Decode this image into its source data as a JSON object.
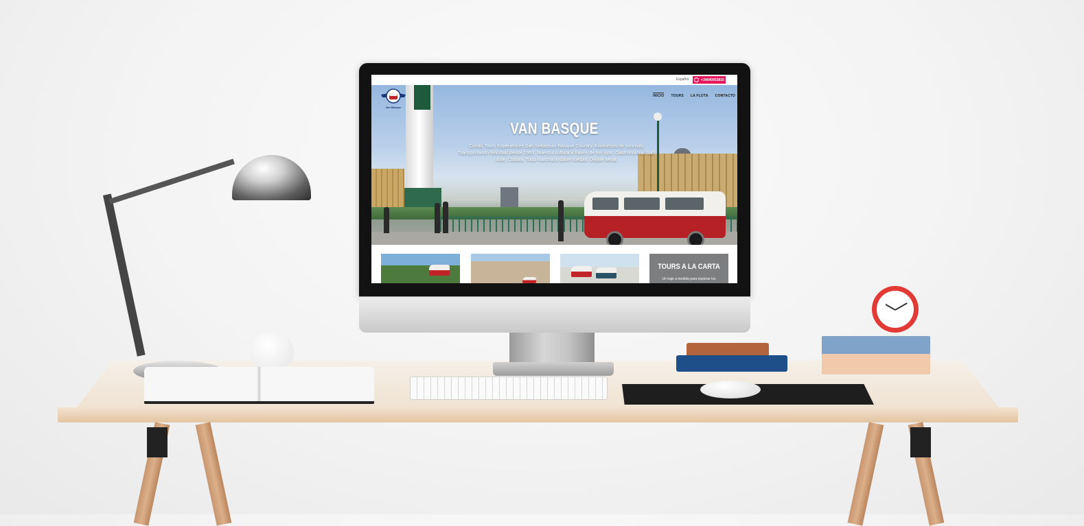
{
  "website": {
    "topbar": {
      "language": "Español",
      "phone": "+34640953816"
    },
    "logo": {
      "label": "Van Basque"
    },
    "nav": [
      "INICIO",
      "TOURS",
      "LA FLOTA",
      "CONTACTO"
    ],
    "hero": {
      "title": "VAN BASQUE",
      "description": "Combi Tours Experiences San Sebastián-Basque Country. Kilómetros de sonrisas. Transportando felicidad desde 1963. Nuestra cultura a través de tus ojos. Gastronomía, Surf, Arte, Cultura. Todo marchará sobre ruedas. Déjate llevar."
    },
    "cards": {
      "tours_a_la_carta": {
        "title": "TOURS A LA CARTA",
        "subtitle": "Un traje a medida para explorar los"
      }
    }
  },
  "colors": {
    "accent": "#e6175c",
    "van_red": "#b52124",
    "card_gray": "#7c7e80"
  }
}
